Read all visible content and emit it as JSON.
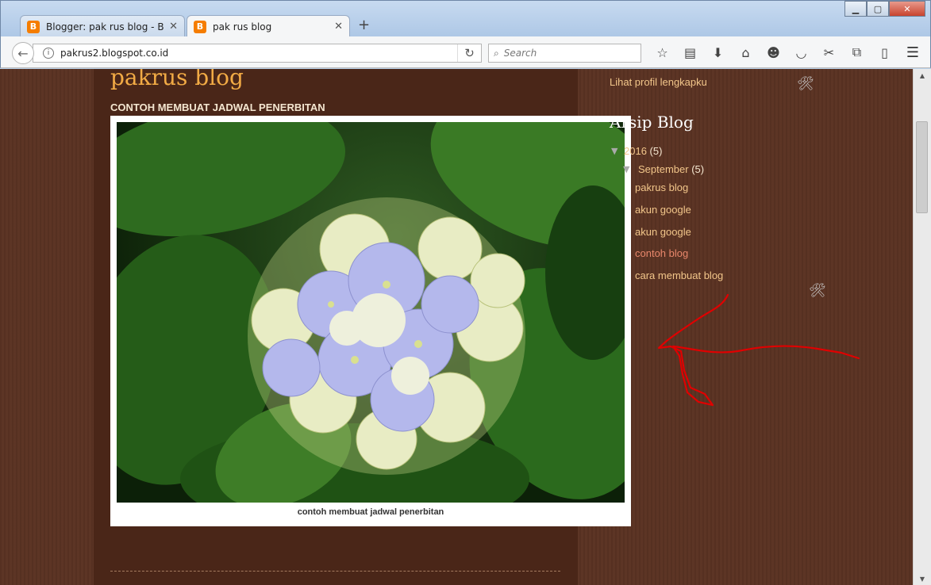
{
  "browser": {
    "tabs": [
      {
        "label": "Blogger: pak rus blog - Bua...",
        "icon": "blogger-icon",
        "active": false
      },
      {
        "label": "pak rus blog",
        "icon": "blogger-icon",
        "active": true
      }
    ],
    "favicon_glyph": "B",
    "new_tab": "+",
    "url": "pakrus2.blogspot.co.id",
    "search_placeholder": "Search",
    "toolbar_icons": [
      "star-icon",
      "reading-list-icon",
      "download-icon",
      "home-icon",
      "emoji-icon",
      "pocket-icon",
      "scissors-icon",
      "translate-icon",
      "clipboard-icon"
    ],
    "menu_icon": "hamburger-icon"
  },
  "blog": {
    "title": "pakrus blog",
    "post_title": "CONTOH MEMBUAT JADWAL PENERBITAN",
    "image_caption": "contoh membuat jadwal penerbitan"
  },
  "sidebar": {
    "profile_link": "Lihat profil lengkapku",
    "archive_title": "Arsip Blog",
    "year": {
      "label": "2016",
      "count": "(5)"
    },
    "month": {
      "label": "September",
      "count": "(5)"
    },
    "posts": [
      {
        "label": "pakrus blog",
        "active": false
      },
      {
        "label": "akun google",
        "active": false
      },
      {
        "label": "akun google",
        "active": false
      },
      {
        "label": "contoh blog",
        "active": true
      },
      {
        "label": "cara membuat blog",
        "active": false
      }
    ]
  },
  "colors": {
    "page_bg": "#5a3222",
    "main_bg": "#4a2618",
    "blog_title": "#f2ab45",
    "link": "#f2c68a",
    "active_link": "#e8876b",
    "annotation": "#e00000"
  }
}
